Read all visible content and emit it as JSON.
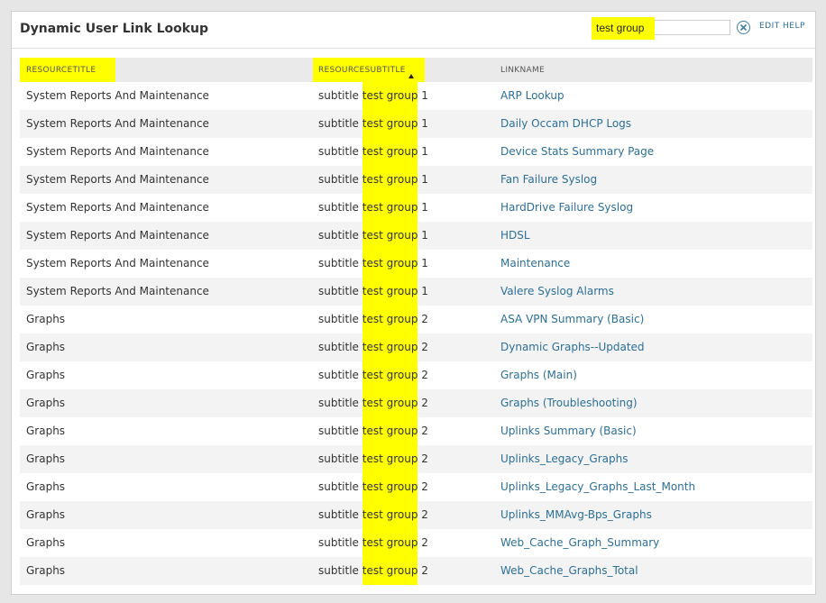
{
  "header": {
    "title": "Dynamic User Link Lookup",
    "search_value": "test group",
    "edit_label": "EDIT",
    "help_label": "HELP",
    "clear_icon": "close-circle-icon"
  },
  "table": {
    "columns": [
      {
        "label": "RESOURCETITLE",
        "highlighted": true
      },
      {
        "label": "RESOURCESUBTITLE",
        "highlighted": true,
        "sort": "ascending"
      },
      {
        "label": "LINKNAME",
        "highlighted": false
      }
    ],
    "highlight_color": "#ffff00",
    "link_color": "#2c6f97",
    "rows": [
      {
        "title": "System Reports And Maintenance",
        "subtitle_prefix": "subtitle ",
        "subtitle_match": "test group",
        "subtitle_suffix": " 1",
        "link": "ARP Lookup"
      },
      {
        "title": "System Reports And Maintenance",
        "subtitle_prefix": "subtitle ",
        "subtitle_match": "test group",
        "subtitle_suffix": " 1",
        "link": "Daily Occam DHCP Logs"
      },
      {
        "title": "System Reports And Maintenance",
        "subtitle_prefix": "subtitle ",
        "subtitle_match": "test group",
        "subtitle_suffix": " 1",
        "link": "Device Stats Summary Page"
      },
      {
        "title": "System Reports And Maintenance",
        "subtitle_prefix": "subtitle ",
        "subtitle_match": "test group",
        "subtitle_suffix": " 1",
        "link": "Fan Failure Syslog"
      },
      {
        "title": "System Reports And Maintenance",
        "subtitle_prefix": "subtitle ",
        "subtitle_match": "test group",
        "subtitle_suffix": " 1",
        "link": "HardDrive Failure Syslog"
      },
      {
        "title": "System Reports And Maintenance",
        "subtitle_prefix": "subtitle ",
        "subtitle_match": "test group",
        "subtitle_suffix": " 1",
        "link": "HDSL"
      },
      {
        "title": "System Reports And Maintenance",
        "subtitle_prefix": "subtitle ",
        "subtitle_match": "test group",
        "subtitle_suffix": " 1",
        "link": "Maintenance"
      },
      {
        "title": "System Reports And Maintenance",
        "subtitle_prefix": "subtitle ",
        "subtitle_match": "test group",
        "subtitle_suffix": " 1",
        "link": "Valere Syslog Alarms"
      },
      {
        "title": "Graphs",
        "subtitle_prefix": "subtitle ",
        "subtitle_match": "test group",
        "subtitle_suffix": " 2",
        "link": "ASA VPN Summary (Basic)"
      },
      {
        "title": "Graphs",
        "subtitle_prefix": "subtitle ",
        "subtitle_match": "test group",
        "subtitle_suffix": " 2",
        "link": "Dynamic Graphs--Updated"
      },
      {
        "title": "Graphs",
        "subtitle_prefix": "subtitle ",
        "subtitle_match": "test group",
        "subtitle_suffix": " 2",
        "link": "Graphs (Main)"
      },
      {
        "title": "Graphs",
        "subtitle_prefix": "subtitle ",
        "subtitle_match": "test group",
        "subtitle_suffix": " 2",
        "link": "Graphs (Troubleshooting)"
      },
      {
        "title": "Graphs",
        "subtitle_prefix": "subtitle ",
        "subtitle_match": "test group",
        "subtitle_suffix": " 2",
        "link": "Uplinks Summary (Basic)"
      },
      {
        "title": "Graphs",
        "subtitle_prefix": "subtitle ",
        "subtitle_match": "test group",
        "subtitle_suffix": " 2",
        "link": "Uplinks_Legacy_Graphs"
      },
      {
        "title": "Graphs",
        "subtitle_prefix": "subtitle ",
        "subtitle_match": "test group",
        "subtitle_suffix": " 2",
        "link": "Uplinks_Legacy_Graphs_Last_Month"
      },
      {
        "title": "Graphs",
        "subtitle_prefix": "subtitle ",
        "subtitle_match": "test group",
        "subtitle_suffix": " 2",
        "link": "Uplinks_MMAvg-Bps_Graphs"
      },
      {
        "title": "Graphs",
        "subtitle_prefix": "subtitle ",
        "subtitle_match": "test group",
        "subtitle_suffix": " 2",
        "link": "Web_Cache_Graph_Summary"
      },
      {
        "title": "Graphs",
        "subtitle_prefix": "subtitle ",
        "subtitle_match": "test group",
        "subtitle_suffix": " 2",
        "link": "Web_Cache_Graphs_Total"
      }
    ]
  }
}
